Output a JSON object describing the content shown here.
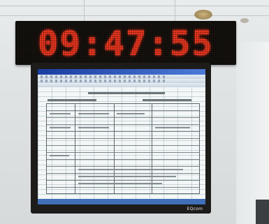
{
  "scene": {
    "led_clock": {
      "time_text": "09:47:55",
      "led_color": "#ff3b22"
    },
    "whiteboard": {
      "brand_text": "EQcom"
    }
  }
}
